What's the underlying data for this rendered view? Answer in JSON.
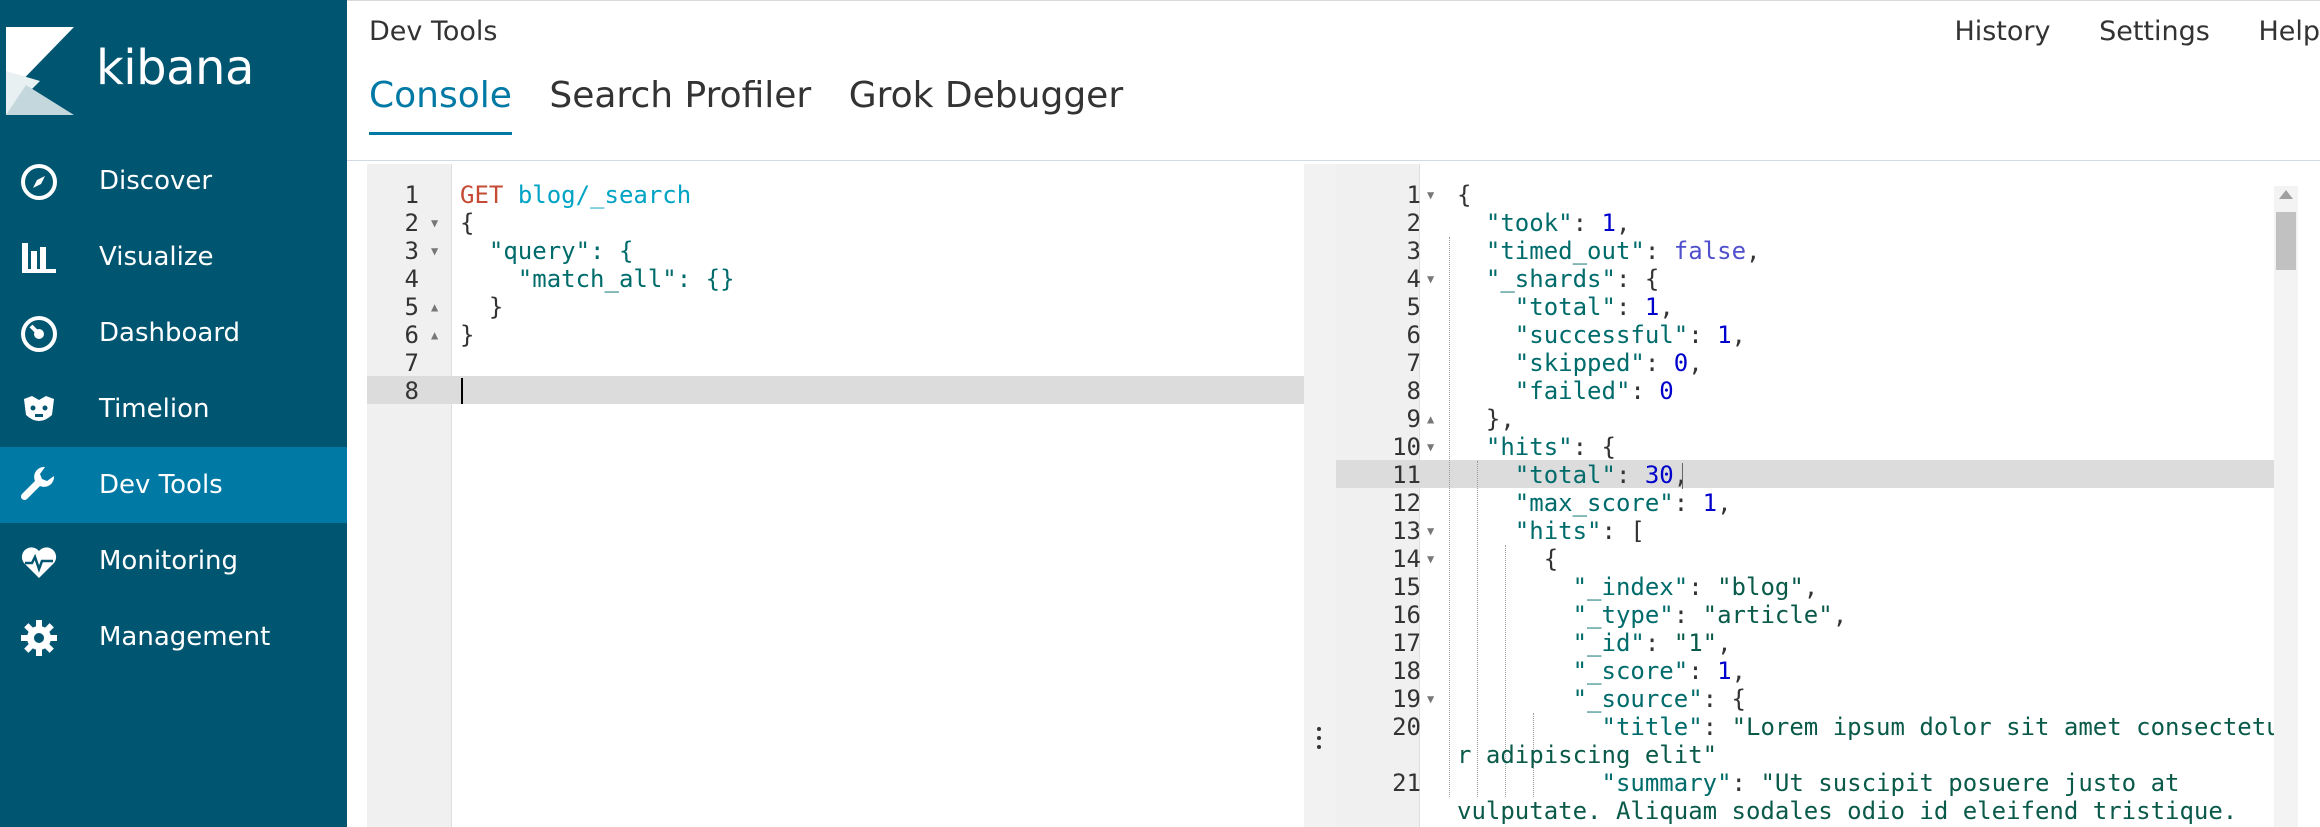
{
  "sidebar": {
    "brand": "kibana",
    "items": [
      {
        "label": "Discover",
        "icon": "compass-icon"
      },
      {
        "label": "Visualize",
        "icon": "bar-chart-icon"
      },
      {
        "label": "Dashboard",
        "icon": "dashboard-icon"
      },
      {
        "label": "Timelion",
        "icon": "timelion-icon"
      },
      {
        "label": "Dev Tools",
        "icon": "wrench-icon",
        "active": true
      },
      {
        "label": "Monitoring",
        "icon": "heartbeat-icon"
      },
      {
        "label": "Management",
        "icon": "gear-icon"
      }
    ]
  },
  "header": {
    "title": "Dev Tools",
    "links": [
      "History",
      "Settings",
      "Help"
    ],
    "tabs": [
      "Console",
      "Search Profiler",
      "Grok Debugger"
    ],
    "active_tab": "Console"
  },
  "request_editor": {
    "method": "GET",
    "path": "blog/_search",
    "line_numbers": [
      "1",
      "2",
      "3",
      "4",
      "5",
      "6",
      "7",
      "8"
    ],
    "lines": [
      "{",
      "  \"query\": {",
      "    \"match_all\": {}",
      "  }",
      "}"
    ],
    "active_line": "8"
  },
  "response_viewer": {
    "line_numbers": [
      "1",
      "2",
      "3",
      "4",
      "5",
      "6",
      "7",
      "8",
      "9",
      "10",
      "11",
      "12",
      "13",
      "14",
      "15",
      "16",
      "17",
      "18",
      "19",
      "20",
      "21"
    ],
    "active_line": "11",
    "values": {
      "took": "1",
      "timed_out": "false",
      "total_shards": "1",
      "successful": "1",
      "skipped": "0",
      "failed": "0",
      "hits_total": "30",
      "max_score": "1",
      "index": "\"blog\"",
      "type": "\"article\"",
      "id": "\"1\"",
      "score": "1",
      "title_part1": "\"Lorem ipsum dolor sit amet consectetu",
      "title_part2": "r adipiscing elit\"",
      "summary_part1": "\"Ut suscipit posuere justo at",
      "summary_part2": "vulputate. Aliquam sodales odio id eleifend tristique."
    }
  },
  "colors": {
    "sidebar_bg": "#005571",
    "sidebar_active": "#0079a5",
    "accent": "#0079a5",
    "method": "#c54b36",
    "url": "#00a3c4",
    "json_key": "#006b6b",
    "json_number": "#0000cc"
  }
}
